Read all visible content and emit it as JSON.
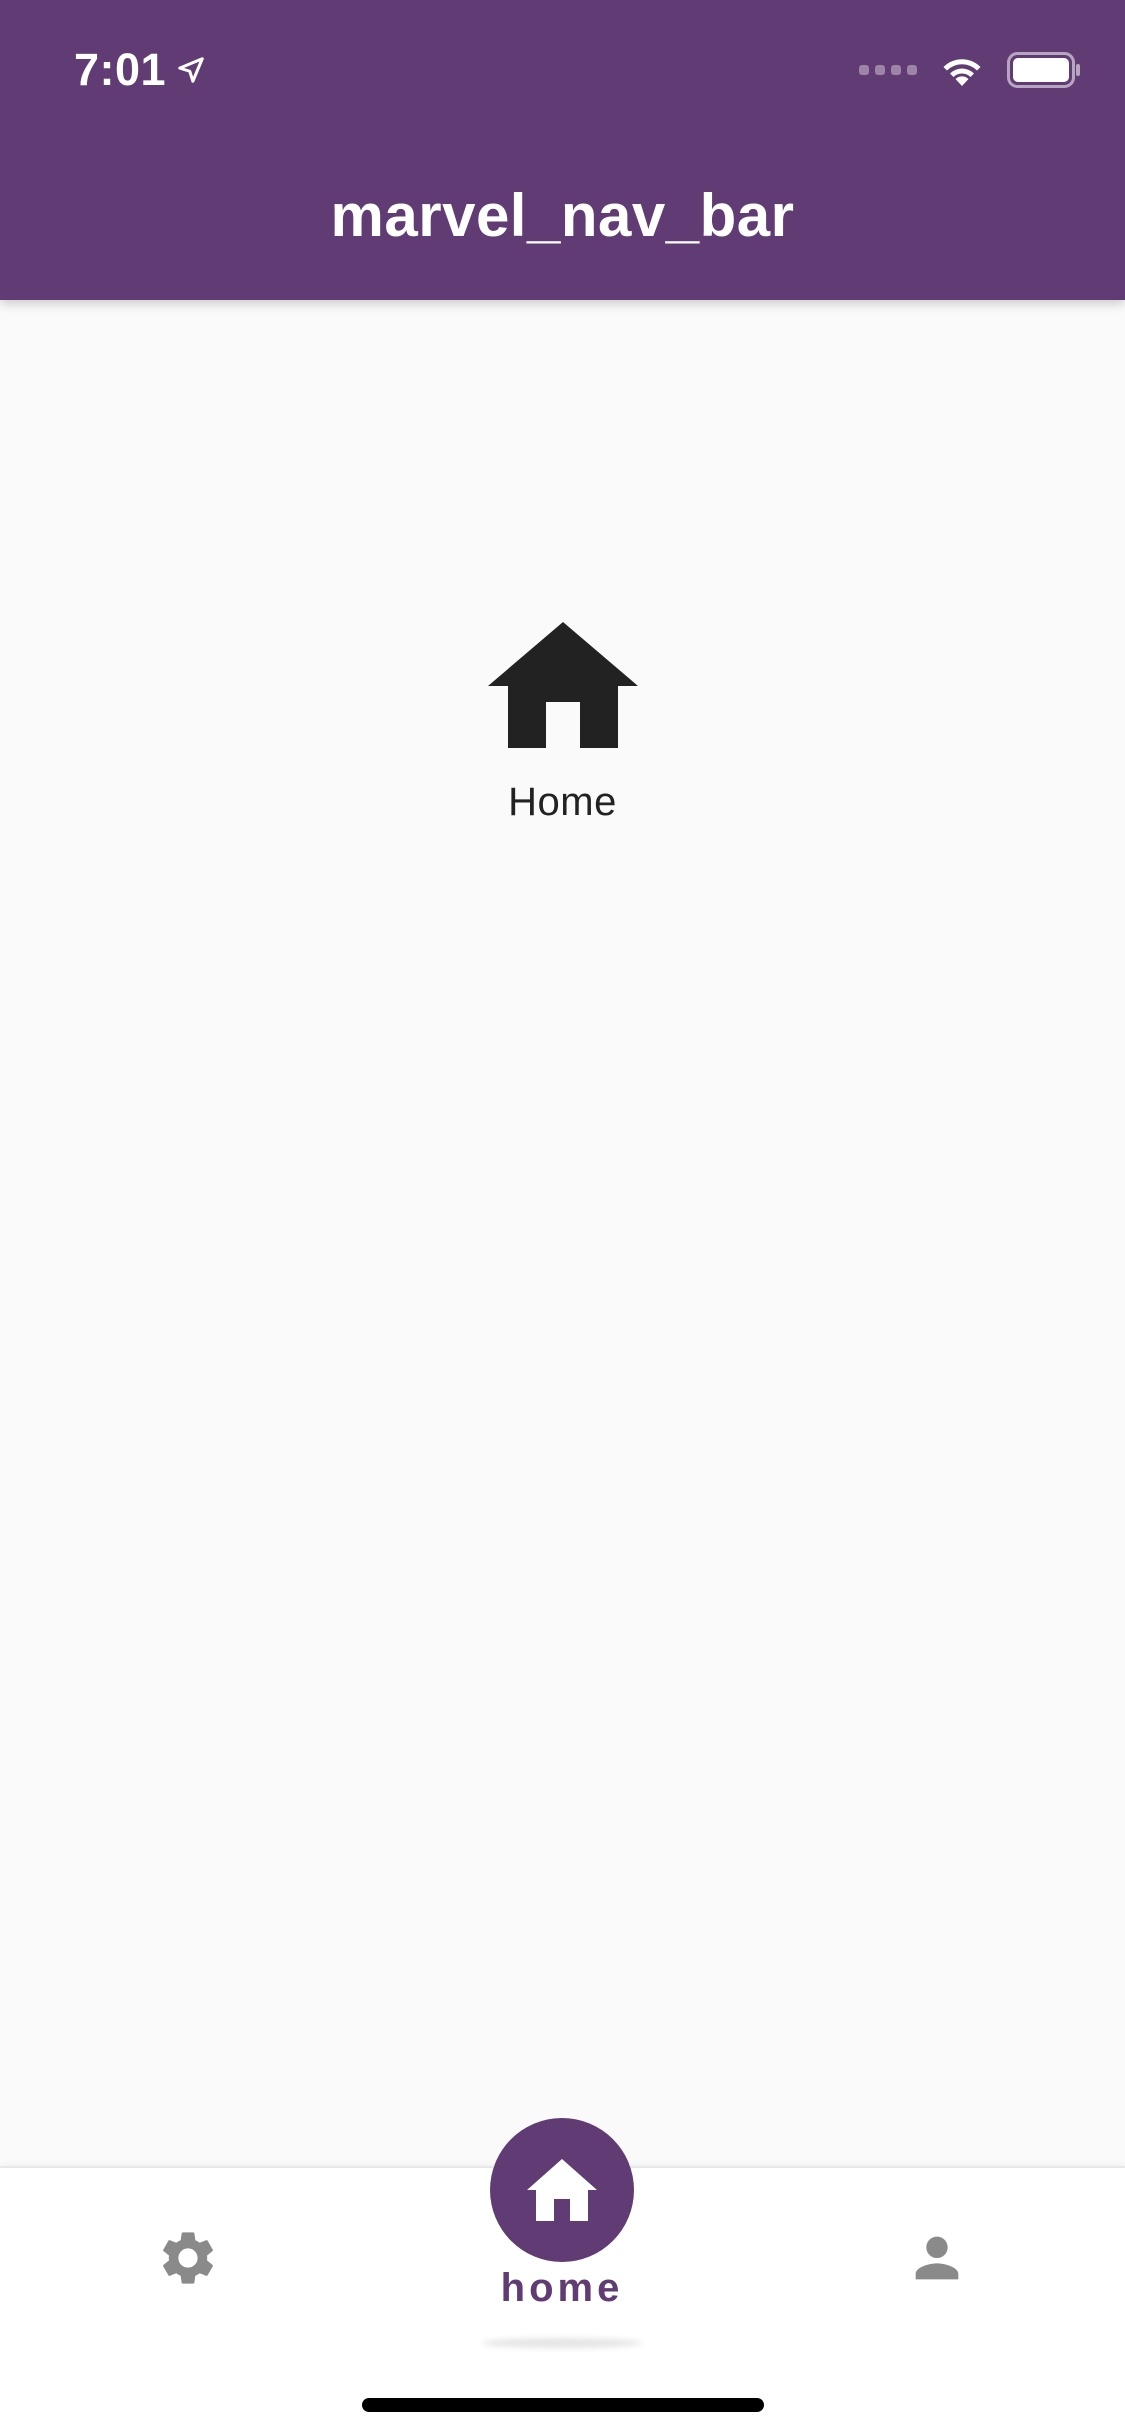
{
  "status_bar": {
    "time": "7:01",
    "location_icon": "location-arrow-icon",
    "signal_icon": "cellular-signal-icon",
    "wifi_icon": "wifi-icon",
    "battery_icon": "battery-icon"
  },
  "app_bar": {
    "title": "marvel_nav_bar",
    "background_color": "#613b73"
  },
  "content": {
    "icon": "home-icon",
    "label": "Home"
  },
  "bottom_nav": {
    "items": [
      {
        "id": "settings",
        "icon": "gear-icon",
        "selected": false
      },
      {
        "id": "home",
        "icon": "home-icon",
        "label": "home",
        "selected": true
      },
      {
        "id": "profile",
        "icon": "person-icon",
        "selected": false
      }
    ],
    "active_color": "#613b73",
    "inactive_color": "#8a8a8a"
  }
}
